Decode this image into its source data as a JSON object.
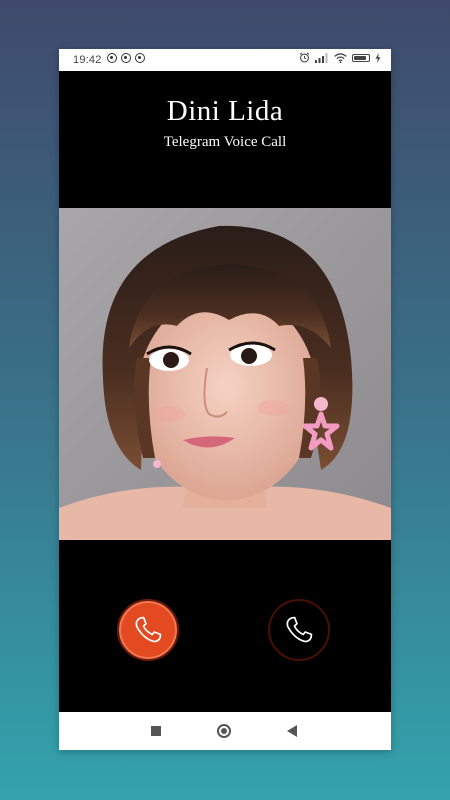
{
  "status_bar": {
    "time": "19:42",
    "left_icons": [
      "whatsapp-icon",
      "app-notification-icon",
      "app-notification-icon"
    ],
    "right_icons": [
      "alarm-icon",
      "signal-icon",
      "wifi-icon",
      "battery-icon",
      "charging-icon"
    ],
    "battery_level": 0.85
  },
  "call": {
    "caller_name": "Dini Lida",
    "call_type": "Telegram Voice Call"
  },
  "buttons": {
    "decline_icon": "phone-icon",
    "accept_icon": "phone-icon"
  },
  "colors": {
    "decline": "#e34a22",
    "accept_ring": "#4a0f05",
    "background_top": "#3f4a6b",
    "background_bottom": "#33a3ad"
  },
  "nav_bar": {
    "icons": [
      "recent-apps-icon",
      "home-icon",
      "back-icon"
    ]
  }
}
